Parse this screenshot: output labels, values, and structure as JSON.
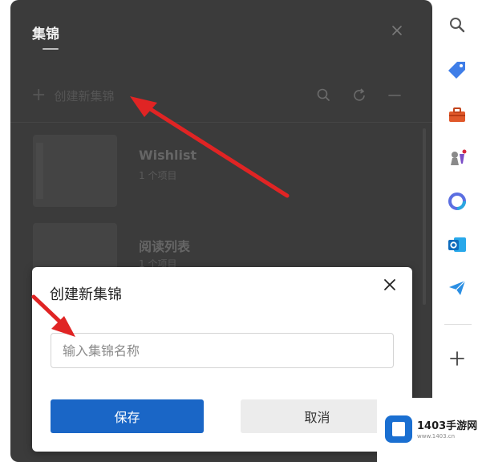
{
  "collections_panel": {
    "title": "集锦",
    "new_collection_label": "创建新集锦",
    "items": [
      {
        "name": "Wishlist",
        "count": "1 个项目"
      },
      {
        "name": "阅读列表",
        "count": "1 个项目"
      }
    ]
  },
  "dialog": {
    "title": "创建新集锦",
    "input_placeholder": "输入集锦名称",
    "input_value": "",
    "save_label": "保存",
    "cancel_label": "取消"
  },
  "sidebar": {
    "icons": [
      "search-icon",
      "tag-icon",
      "toolbox-icon",
      "chess-icon",
      "office-icon",
      "outlook-icon",
      "send-icon",
      "add-icon"
    ]
  },
  "watermark": {
    "brand": "1403手游网",
    "url": "www.1403.cn"
  },
  "colors": {
    "accent": "#1a66c6",
    "annotation": "#e02424",
    "panel_dim": "#3b3b3b"
  }
}
